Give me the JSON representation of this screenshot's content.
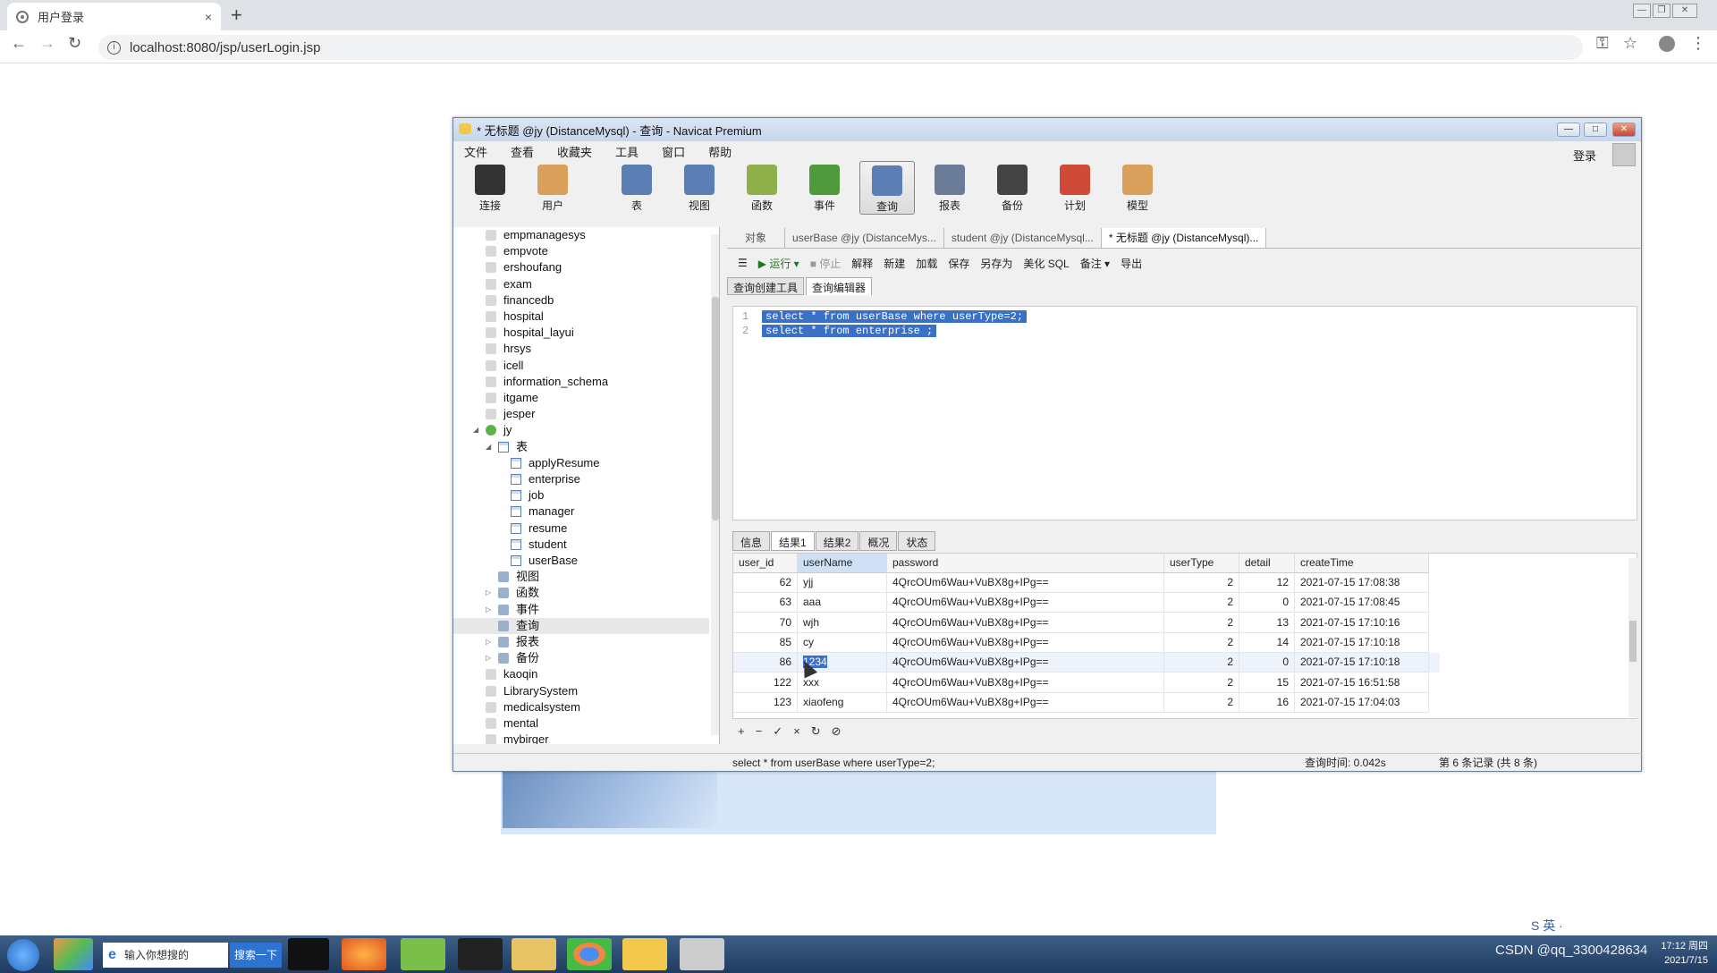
{
  "browser": {
    "tab_title": "用户登录",
    "tab_close": "×",
    "new_tab": "+",
    "url": "localhost:8080/jsp/userLogin.jsp",
    "back": "←",
    "forward": "→",
    "reload": "↻",
    "key_icon": "⚿",
    "star_icon": "☆",
    "menu_icon": "⋮"
  },
  "navicat": {
    "title": "* 无标题 @jy (DistanceMysql) - 查询 - Navicat Premium",
    "menu": [
      "文件",
      "查看",
      "收藏夹",
      "工具",
      "窗口",
      "帮助"
    ],
    "login": "登录",
    "toolbar": [
      {
        "label": "连接",
        "color": "#333333"
      },
      {
        "label": "用户",
        "color": "#d9a05b"
      },
      {
        "label": "表",
        "color": "#5b7fb5"
      },
      {
        "label": "视图",
        "color": "#5b7fb5"
      },
      {
        "label": "函数",
        "color": "#8fb04a"
      },
      {
        "label": "事件",
        "color": "#4e9a3c"
      },
      {
        "label": "查询",
        "color": "#5b7fb5"
      },
      {
        "label": "报表",
        "color": "#6b7c99"
      },
      {
        "label": "备份",
        "color": "#444444"
      },
      {
        "label": "计划",
        "color": "#d04a3a"
      },
      {
        "label": "模型",
        "color": "#d9a05b"
      }
    ],
    "tree": [
      {
        "label": "empmanagesys",
        "level": 1,
        "kind": "db"
      },
      {
        "label": "empvote",
        "level": 1,
        "kind": "db"
      },
      {
        "label": "ershoufang",
        "level": 1,
        "kind": "db"
      },
      {
        "label": "exam",
        "level": 1,
        "kind": "db"
      },
      {
        "label": "financedb",
        "level": 1,
        "kind": "db"
      },
      {
        "label": "hospital",
        "level": 1,
        "kind": "db"
      },
      {
        "label": "hospital_layui",
        "level": 1,
        "kind": "db"
      },
      {
        "label": "hrsys",
        "level": 1,
        "kind": "db"
      },
      {
        "label": "icell",
        "level": 1,
        "kind": "db"
      },
      {
        "label": "information_schema",
        "level": 1,
        "kind": "db"
      },
      {
        "label": "itgame",
        "level": 1,
        "kind": "db"
      },
      {
        "label": "jesper",
        "level": 1,
        "kind": "db"
      },
      {
        "label": "jy",
        "level": 1,
        "kind": "dbo",
        "arrow": "◢"
      },
      {
        "label": "表",
        "level": 2,
        "kind": "tbl",
        "arrow": "◢"
      },
      {
        "label": "applyResume",
        "level": 3,
        "kind": "tbl"
      },
      {
        "label": "enterprise",
        "level": 3,
        "kind": "tbl"
      },
      {
        "label": "job",
        "level": 3,
        "kind": "tbl"
      },
      {
        "label": "manager",
        "level": 3,
        "kind": "tbl"
      },
      {
        "label": "resume",
        "level": 3,
        "kind": "tbl"
      },
      {
        "label": "student",
        "level": 3,
        "kind": "tbl"
      },
      {
        "label": "userBase",
        "level": 3,
        "kind": "tbl"
      },
      {
        "label": "视图",
        "level": 2,
        "kind": "misc"
      },
      {
        "label": "函数",
        "level": 2,
        "kind": "misc",
        "arrow": "▷"
      },
      {
        "label": "事件",
        "level": 2,
        "kind": "misc",
        "arrow": "▷"
      },
      {
        "label": "查询",
        "level": 2,
        "kind": "misc",
        "hl": true
      },
      {
        "label": "报表",
        "level": 2,
        "kind": "misc",
        "arrow": "▷"
      },
      {
        "label": "备份",
        "level": 2,
        "kind": "misc",
        "arrow": "▷"
      },
      {
        "label": "kaoqin",
        "level": 1,
        "kind": "db"
      },
      {
        "label": "LibrarySystem",
        "level": 1,
        "kind": "db"
      },
      {
        "label": "medicalsystem",
        "level": 1,
        "kind": "db"
      },
      {
        "label": "mental",
        "level": 1,
        "kind": "db"
      },
      {
        "label": "mybirger",
        "level": 1,
        "kind": "db"
      }
    ],
    "doc_tabs": [
      "对象",
      "userBase @jy (DistanceMys...",
      "student @jy (DistanceMysql...",
      "* 无标题 @jy (DistanceMysql)..."
    ],
    "query_toolbar": [
      "☰",
      "▶ 运行 ▾",
      "■ 停止",
      "解释",
      "新建",
      "加载",
      "保存",
      "另存为",
      "美化 SQL",
      "备注 ▾",
      "导出"
    ],
    "sub_tabs": [
      "查询创建工具",
      "查询编辑器"
    ],
    "code_lines": [
      "select * from userBase where userType=2;",
      "select * from enterprise ;"
    ],
    "line_numbers": [
      "1",
      "2"
    ],
    "result_tabs": [
      "信息",
      "结果1",
      "结果2",
      "概况",
      "状态"
    ],
    "columns": [
      "user_id",
      "userName",
      "password",
      "userType",
      "detail",
      "createTime"
    ],
    "rows": [
      [
        "62",
        "yjj",
        "4QrcOUm6Wau+VuBX8g+IPg==",
        "2",
        "12",
        "2021-07-15 17:08:38"
      ],
      [
        "63",
        "aaa",
        "4QrcOUm6Wau+VuBX8g+IPg==",
        "2",
        "0",
        "2021-07-15 17:08:45"
      ],
      [
        "70",
        "wjh",
        "4QrcOUm6Wau+VuBX8g+IPg==",
        "2",
        "13",
        "2021-07-15 17:10:16"
      ],
      [
        "85",
        "cy",
        "4QrcOUm6Wau+VuBX8g+IPg==",
        "2",
        "14",
        "2021-07-15 17:10:18"
      ],
      [
        "86",
        "1234",
        "4QrcOUm6Wau+VuBX8g+IPg==",
        "2",
        "0",
        "2021-07-15 17:10:18"
      ],
      [
        "122",
        "xxx",
        "4QrcOUm6Wau+VuBX8g+IPg==",
        "2",
        "15",
        "2021-07-15 16:51:58"
      ],
      [
        "123",
        "xiaofeng",
        "4QrcOUm6Wau+VuBX8g+IPg==",
        "2",
        "16",
        "2021-07-15 17:04:03"
      ]
    ],
    "grid_nav": [
      "+",
      "−",
      "✓",
      "×",
      "↻",
      "⊘"
    ],
    "status_sql": "select * from userBase where userType=2;",
    "status_time": "查询时间: 0.042s",
    "status_records": "第 6 条记录 (共 8 条)"
  },
  "taskbar": {
    "search_placeholder": "输入你想搜的",
    "search_button": "搜索一下",
    "tray_time": "17:12 周四",
    "tray_date": "2021/7/15",
    "watermark": "CSDN @qq_3300428634",
    "ime": "S 英 ·"
  }
}
